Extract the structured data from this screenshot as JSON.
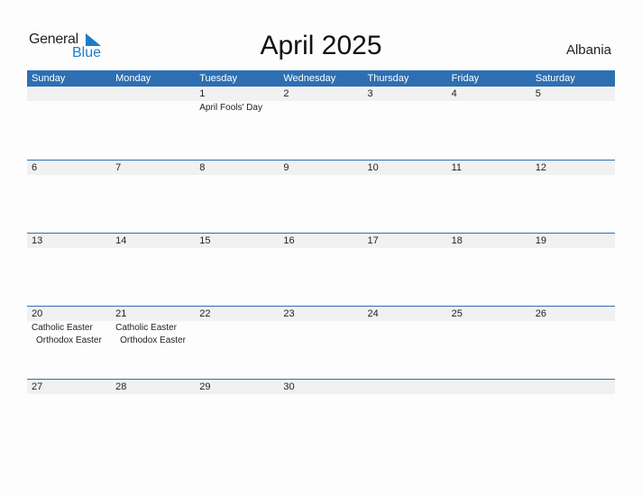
{
  "logo": {
    "line1": "General",
    "line2": "Blue",
    "accent_color": "#1e7bc7"
  },
  "title": "April 2025",
  "country": "Albania",
  "header_color": "#2e6fb2",
  "weekdays": [
    "Sunday",
    "Monday",
    "Tuesday",
    "Wednesday",
    "Thursday",
    "Friday",
    "Saturday"
  ],
  "weeks": [
    {
      "days": [
        {
          "num": "",
          "events": []
        },
        {
          "num": "",
          "events": []
        },
        {
          "num": "1",
          "events": [
            "April Fools' Day"
          ]
        },
        {
          "num": "2",
          "events": []
        },
        {
          "num": "3",
          "events": []
        },
        {
          "num": "4",
          "events": []
        },
        {
          "num": "5",
          "events": []
        }
      ]
    },
    {
      "days": [
        {
          "num": "6",
          "events": []
        },
        {
          "num": "7",
          "events": []
        },
        {
          "num": "8",
          "events": []
        },
        {
          "num": "9",
          "events": []
        },
        {
          "num": "10",
          "events": []
        },
        {
          "num": "11",
          "events": []
        },
        {
          "num": "12",
          "events": []
        }
      ]
    },
    {
      "days": [
        {
          "num": "13",
          "events": []
        },
        {
          "num": "14",
          "events": []
        },
        {
          "num": "15",
          "events": []
        },
        {
          "num": "16",
          "events": []
        },
        {
          "num": "17",
          "events": []
        },
        {
          "num": "18",
          "events": []
        },
        {
          "num": "19",
          "events": []
        }
      ]
    },
    {
      "days": [
        {
          "num": "20",
          "events": [
            "Catholic Easter",
            "Orthodox Easter"
          ]
        },
        {
          "num": "21",
          "events": [
            "Catholic Easter",
            "Orthodox Easter"
          ]
        },
        {
          "num": "22",
          "events": []
        },
        {
          "num": "23",
          "events": []
        },
        {
          "num": "24",
          "events": []
        },
        {
          "num": "25",
          "events": []
        },
        {
          "num": "26",
          "events": []
        }
      ]
    },
    {
      "days": [
        {
          "num": "27",
          "events": []
        },
        {
          "num": "28",
          "events": []
        },
        {
          "num": "29",
          "events": []
        },
        {
          "num": "30",
          "events": []
        },
        {
          "num": "",
          "events": []
        },
        {
          "num": "",
          "events": []
        },
        {
          "num": "",
          "events": []
        }
      ]
    }
  ]
}
